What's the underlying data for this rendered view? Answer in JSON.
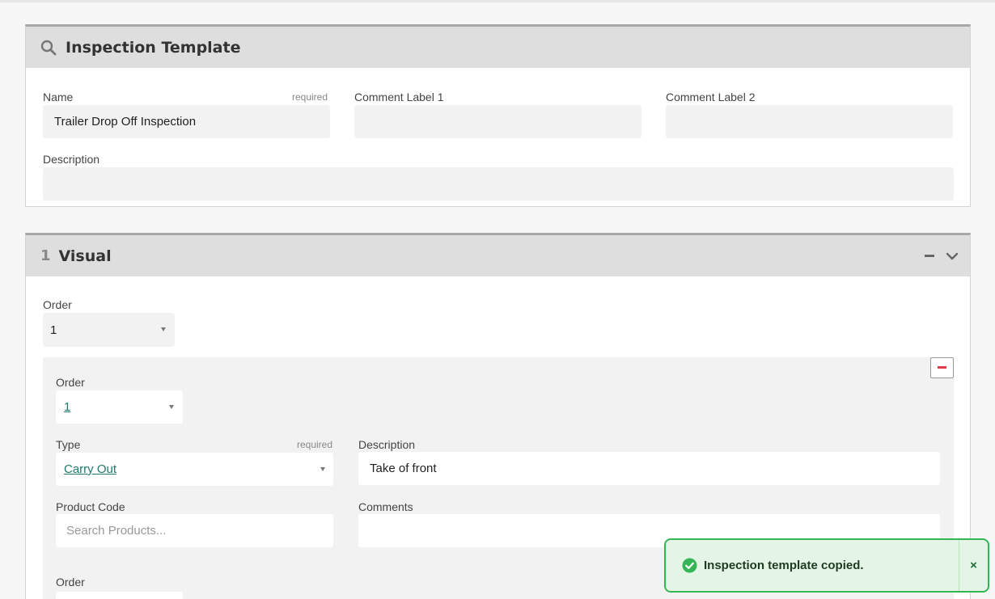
{
  "template_panel": {
    "title": "Inspection Template",
    "name_label": "Name",
    "name_required": "required",
    "name_value": "Trailer Drop Off Inspection",
    "comment_label_1": "Comment Label 1",
    "comment_label_2": "Comment Label 2",
    "description_label": "Description"
  },
  "section": {
    "number": "1",
    "title": "Visual",
    "order_label": "Order",
    "order_value": "1",
    "item": {
      "order_label": "Order",
      "order_value": "1",
      "type_label": "Type",
      "type_required": "required",
      "type_value": "Carry Out",
      "description_label": "Description",
      "description_value": "Take of front",
      "product_code_label": "Product Code",
      "product_code_placeholder": "Search Products...",
      "comments_label": "Comments"
    },
    "next_order_label": "Order"
  },
  "toast": {
    "message": "Inspection template copied.",
    "close_label": "×"
  },
  "colors": {
    "accent_link": "#1e7a6a",
    "success": "#35b555",
    "remove_red": "#e0394a"
  },
  "icons": {
    "search": "search-icon",
    "collapse": "minus-icon",
    "expand": "chevron-down-icon",
    "remove": "remove-icon",
    "success": "check-circle-icon"
  }
}
